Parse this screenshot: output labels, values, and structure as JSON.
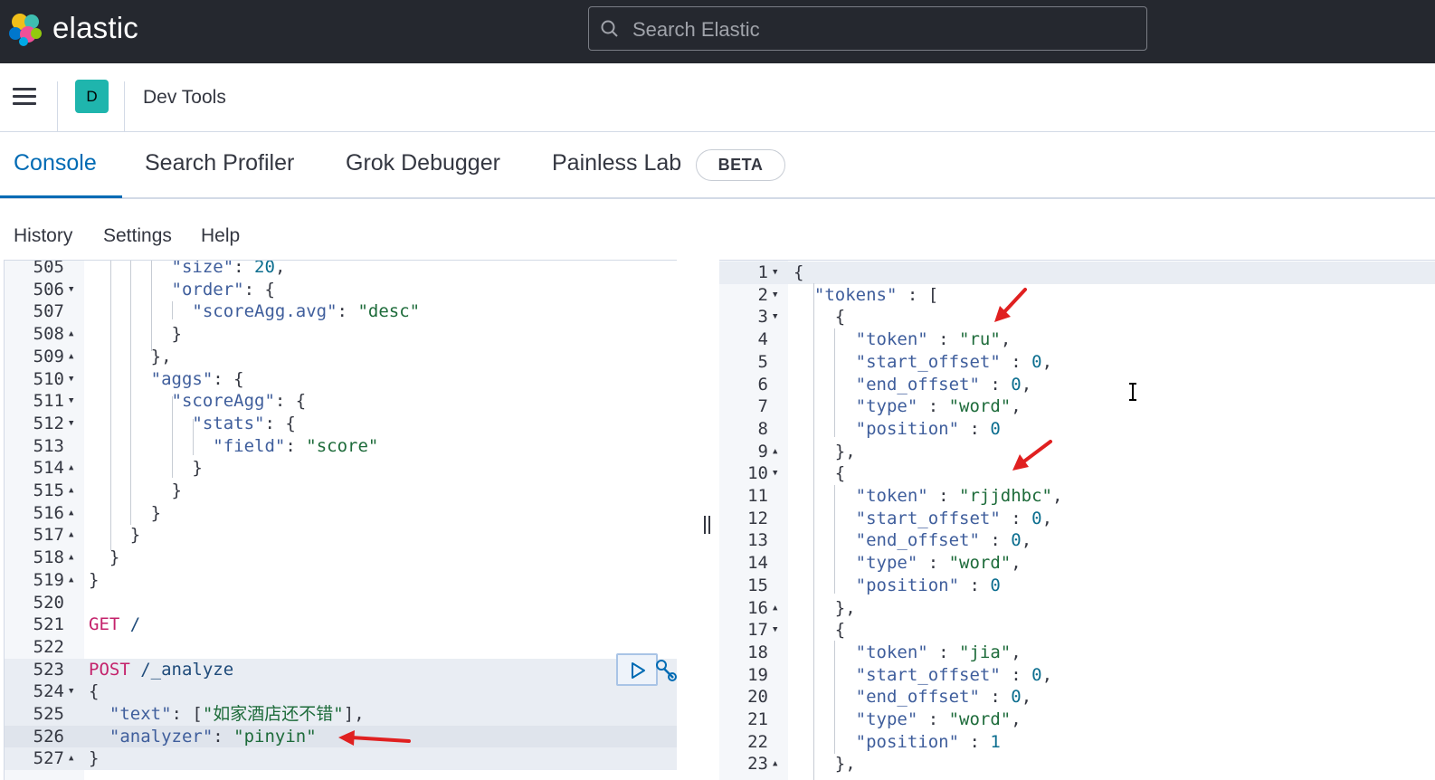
{
  "header": {
    "brand": "elastic",
    "search_placeholder": "Search Elastic"
  },
  "subheader": {
    "space_initial": "D",
    "app_title": "Dev Tools"
  },
  "tabs": [
    {
      "label": "Console",
      "active": true
    },
    {
      "label": "Search Profiler",
      "active": false
    },
    {
      "label": "Grok Debugger",
      "active": false
    },
    {
      "label": "Painless Lab",
      "active": false
    }
  ],
  "beta_badge": "BETA",
  "console_menu": [
    "History",
    "Settings",
    "Help"
  ],
  "colors": {
    "header_bg": "#25282f",
    "accent": "#006bb4",
    "space_badge": "#1fb5ad",
    "annotation_arrow": "#e02020"
  },
  "request_editor": {
    "lines": [
      {
        "n": "505",
        "fold": "",
        "text": "        \"size\": 20,"
      },
      {
        "n": "506",
        "fold": "down",
        "text": "        \"order\": {"
      },
      {
        "n": "507",
        "fold": "",
        "text": "          \"scoreAgg.avg\": \"desc\""
      },
      {
        "n": "508",
        "fold": "up",
        "text": "        }"
      },
      {
        "n": "509",
        "fold": "up",
        "text": "      },"
      },
      {
        "n": "510",
        "fold": "down",
        "text": "      \"aggs\": {"
      },
      {
        "n": "511",
        "fold": "down",
        "text": "        \"scoreAgg\": {"
      },
      {
        "n": "512",
        "fold": "down",
        "text": "          \"stats\": {"
      },
      {
        "n": "513",
        "fold": "",
        "text": "            \"field\": \"score\""
      },
      {
        "n": "514",
        "fold": "up",
        "text": "          }"
      },
      {
        "n": "515",
        "fold": "up",
        "text": "        }"
      },
      {
        "n": "516",
        "fold": "up",
        "text": "      }"
      },
      {
        "n": "517",
        "fold": "up",
        "text": "    }"
      },
      {
        "n": "518",
        "fold": "up",
        "text": "  }"
      },
      {
        "n": "519",
        "fold": "up",
        "text": "}"
      },
      {
        "n": "520",
        "fold": "",
        "text": ""
      },
      {
        "n": "521",
        "fold": "",
        "text": "GET /"
      },
      {
        "n": "522",
        "fold": "",
        "text": ""
      },
      {
        "n": "523",
        "fold": "",
        "text": "POST /_analyze"
      },
      {
        "n": "524",
        "fold": "down",
        "text": "{"
      },
      {
        "n": "525",
        "fold": "",
        "text": "  \"text\": [\"如家酒店还不错\"],"
      },
      {
        "n": "526",
        "fold": "",
        "text": "  \"analyzer\": \"pinyin\""
      },
      {
        "n": "527",
        "fold": "up",
        "text": "}"
      }
    ]
  },
  "response_editor": {
    "lines": [
      {
        "n": "1",
        "fold": "down",
        "text": "{"
      },
      {
        "n": "2",
        "fold": "down",
        "text": "  \"tokens\" : ["
      },
      {
        "n": "3",
        "fold": "down",
        "text": "    {"
      },
      {
        "n": "4",
        "fold": "",
        "text": "      \"token\" : \"ru\","
      },
      {
        "n": "5",
        "fold": "",
        "text": "      \"start_offset\" : 0,"
      },
      {
        "n": "6",
        "fold": "",
        "text": "      \"end_offset\" : 0,"
      },
      {
        "n": "7",
        "fold": "",
        "text": "      \"type\" : \"word\","
      },
      {
        "n": "8",
        "fold": "",
        "text": "      \"position\" : 0"
      },
      {
        "n": "9",
        "fold": "up",
        "text": "    },"
      },
      {
        "n": "10",
        "fold": "down",
        "text": "    {"
      },
      {
        "n": "11",
        "fold": "",
        "text": "      \"token\" : \"rjjdhbc\","
      },
      {
        "n": "12",
        "fold": "",
        "text": "      \"start_offset\" : 0,"
      },
      {
        "n": "13",
        "fold": "",
        "text": "      \"end_offset\" : 0,"
      },
      {
        "n": "14",
        "fold": "",
        "text": "      \"type\" : \"word\","
      },
      {
        "n": "15",
        "fold": "",
        "text": "      \"position\" : 0"
      },
      {
        "n": "16",
        "fold": "up",
        "text": "    },"
      },
      {
        "n": "17",
        "fold": "down",
        "text": "    {"
      },
      {
        "n": "18",
        "fold": "",
        "text": "      \"token\" : \"jia\","
      },
      {
        "n": "19",
        "fold": "",
        "text": "      \"start_offset\" : 0,"
      },
      {
        "n": "20",
        "fold": "",
        "text": "      \"end_offset\" : 0,"
      },
      {
        "n": "21",
        "fold": "",
        "text": "      \"type\" : \"word\","
      },
      {
        "n": "22",
        "fold": "",
        "text": "      \"position\" : 1"
      },
      {
        "n": "23",
        "fold": "up",
        "text": "    },"
      }
    ]
  }
}
